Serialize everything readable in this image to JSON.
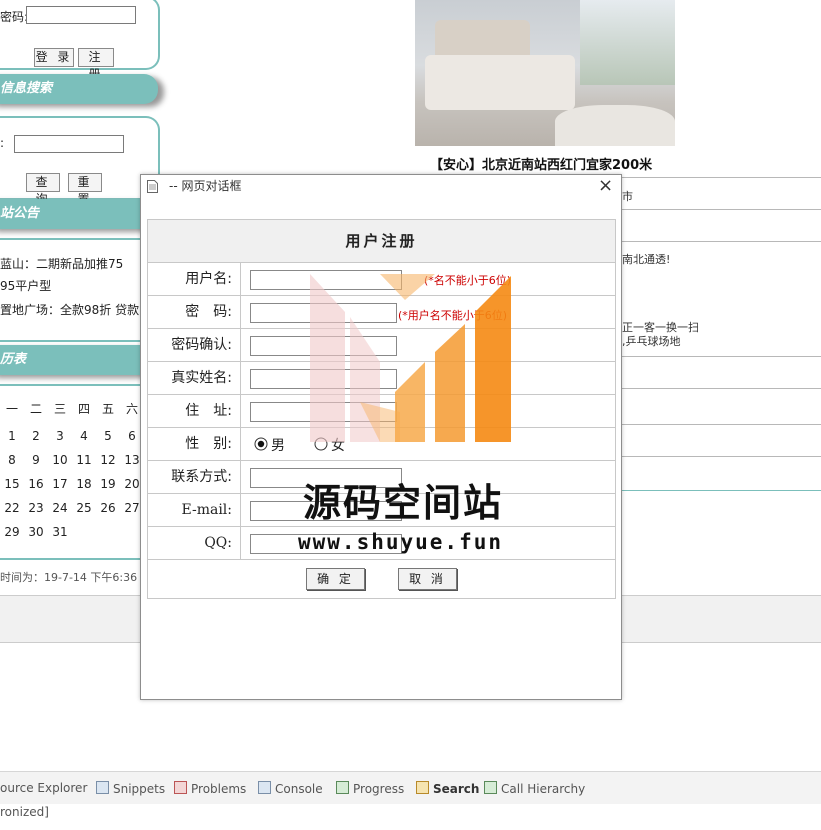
{
  "sidebar": {
    "login": {
      "password_label": "密码:",
      "login_btn": "登 录",
      "register_btn": "注 册"
    },
    "search": {
      "title": "信息搜索",
      "field_label": ":",
      "query_btn": "查 询",
      "reset_btn": "重 置"
    },
    "notice": {
      "title": "站公告",
      "items": [
        "蓝山：二期新品加推75",
        "95平户型",
        "置地广场：全款98折 贷款"
      ]
    },
    "calendar": {
      "title": "历表",
      "weekdays": [
        "一",
        "二",
        "三",
        "四",
        "五",
        "六"
      ],
      "rows": [
        [
          "1",
          "2",
          "3",
          "4",
          "5",
          "6"
        ],
        [
          "8",
          "9",
          "10",
          "11",
          "12",
          "13"
        ],
        [
          "15",
          "16",
          "17",
          "18",
          "19",
          "20"
        ],
        [
          "22",
          "23",
          "24",
          "25",
          "26",
          "27"
        ],
        [
          "29",
          "30",
          "31"
        ]
      ]
    },
    "footer_time": "时间为：19-7-14 下午6:36"
  },
  "listing": {
    "caption": "【安心】北京近南站西红门宜家200米",
    "right_snippets": [
      "南北通透!",
      "正一客一换一扫",
      ",乒乓球场地",
      "市"
    ]
  },
  "dialog": {
    "title": "-- 网页对话框",
    "close": "×",
    "heading": "用户注册",
    "fields": [
      {
        "label": "用户名:",
        "hint": "(*名不能小于6位)"
      },
      {
        "label": "密　码:",
        "hint": "(*用户名不能小于6位)"
      },
      {
        "label": "密码确认:"
      },
      {
        "label": "真实姓名:"
      },
      {
        "label": "住　址:"
      },
      {
        "label": "性　别:"
      },
      {
        "label": "联系方式:"
      },
      {
        "label": "E-mail:"
      },
      {
        "label": "QQ:"
      }
    ],
    "gender": {
      "male": "男",
      "female": "女",
      "selected": "male"
    },
    "confirm_btn": "确 定",
    "cancel_btn": "取 消"
  },
  "watermark": {
    "title": "源码空间站",
    "url": "www.shuyue.fun",
    "colors": [
      "#f0c8c8",
      "#f7a94a",
      "#f58a13"
    ]
  },
  "eclipse": {
    "tabs": [
      "ource Explorer",
      "Snippets",
      "Problems",
      "Console",
      "Progress",
      "Search",
      "Call Hierarchy"
    ],
    "status": "ronized]"
  }
}
